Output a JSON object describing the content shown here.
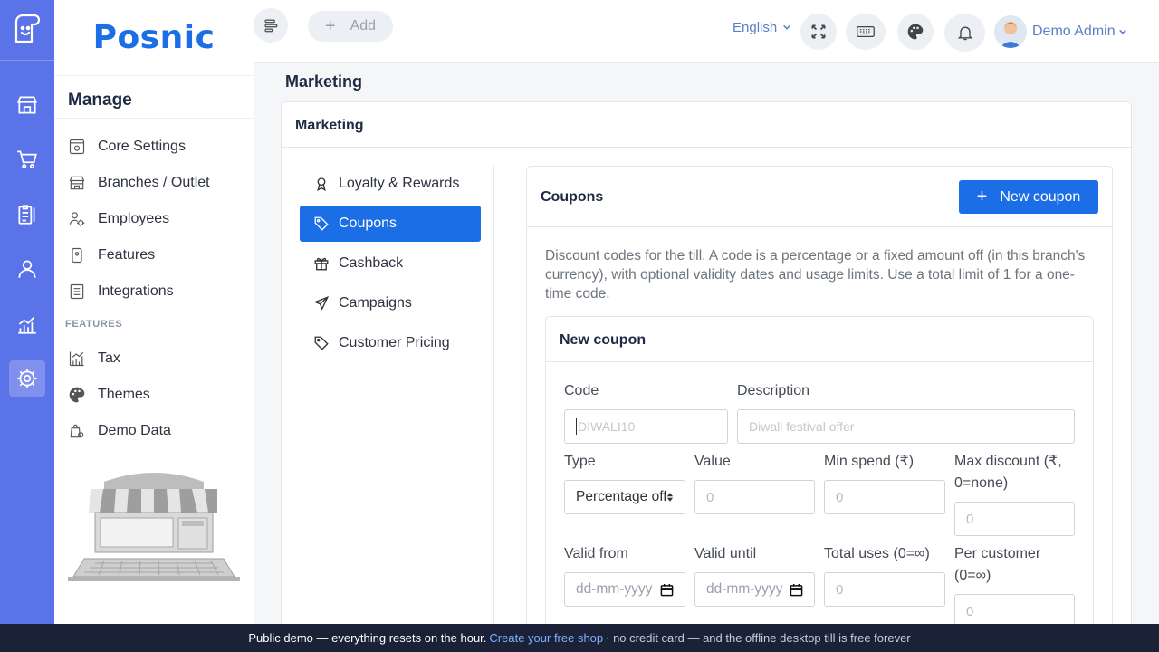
{
  "brand": {
    "name": "Posnic"
  },
  "sidebar": {
    "title": "Manage",
    "items": [
      {
        "label": "Core Settings",
        "icon": "settings-panel-icon"
      },
      {
        "label": "Branches / Outlet",
        "icon": "store-icon"
      },
      {
        "label": "Employees",
        "icon": "employees-gear-icon"
      },
      {
        "label": "Features",
        "icon": "device-icon"
      },
      {
        "label": "Integrations",
        "icon": "list-doc-icon"
      }
    ],
    "section_label": "FEATURES",
    "feature_items": [
      {
        "label": "Tax",
        "icon": "chart-icon"
      },
      {
        "label": "Themes",
        "icon": "palette-icon"
      },
      {
        "label": "Demo Data",
        "icon": "bag-gear-icon"
      }
    ]
  },
  "topbar": {
    "add_label": "Add",
    "language": "English",
    "user_name": "Demo Admin"
  },
  "page": {
    "title": "Marketing",
    "card_title": "Marketing"
  },
  "menu": [
    {
      "label": "Loyalty & Rewards",
      "icon": "award-icon"
    },
    {
      "label": "Coupons",
      "icon": "tag-icon",
      "active": true
    },
    {
      "label": "Cashback",
      "icon": "gift-icon"
    },
    {
      "label": "Campaigns",
      "icon": "send-icon"
    },
    {
      "label": "Customer Pricing",
      "icon": "tag-icon"
    }
  ],
  "coupons": {
    "title": "Coupons",
    "new_button": "New coupon",
    "description": "Discount codes for the till. A code is a percentage or a fixed amount off (in this branch's currency), with optional validity dates and usage limits. Use a total limit of 1 for a one-time code.",
    "form": {
      "title": "New coupon",
      "code_label": "Code",
      "code_placeholder": "DIWALI10",
      "desc_label": "Description",
      "desc_placeholder": "Diwali festival offer",
      "type_label": "Type",
      "type_value": "Percentage off",
      "value_label": "Value",
      "value_placeholder": "0",
      "min_spend_label": "Min spend (₹)",
      "min_spend_placeholder": "0",
      "max_discount_label": "Max discount (₹, 0=none)",
      "max_discount_placeholder": "0",
      "valid_from_label": "Valid from",
      "valid_from_placeholder": "dd-mm-yyyy",
      "valid_until_label": "Valid until",
      "valid_until_placeholder": "dd-mm-yyyy",
      "total_uses_label": "Total uses (0=∞)",
      "total_uses_placeholder": "0",
      "per_customer_label": "Per customer (0=∞)",
      "per_customer_placeholder": "0"
    }
  },
  "footer": {
    "text": "Public demo — everything resets on the hour.",
    "link": "Create your free shop",
    "tail": "· no credit card — and the offline desktop till is free forever"
  },
  "colors": {
    "rail": "#5b73e8",
    "primary": "#1c6ee6",
    "footer": "#1b2238"
  }
}
